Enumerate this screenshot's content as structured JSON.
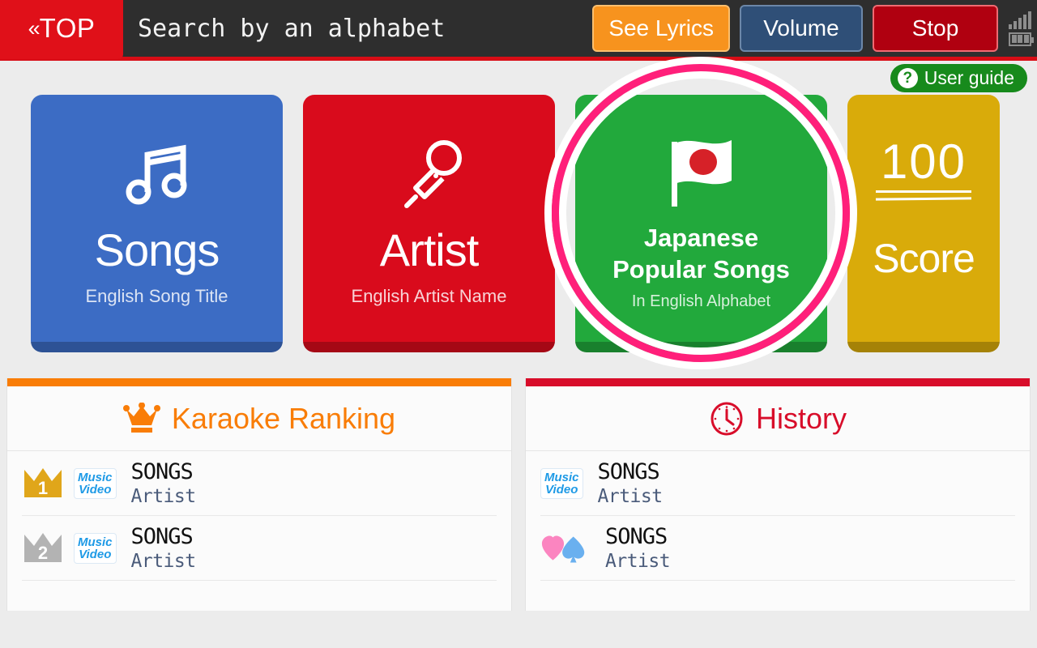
{
  "header": {
    "top_button": "TOP",
    "top_chevron": "«",
    "title": "Search by an alphabet",
    "buttons": [
      {
        "label": "See Lyrics",
        "name": "see-lyrics",
        "color": "#f7931e"
      },
      {
        "label": "Volume",
        "name": "volume",
        "color": "#2f4f77"
      },
      {
        "label": "Stop",
        "name": "stop",
        "color": "#b00010"
      }
    ],
    "status": {
      "signal_icon": "signal-bars-icon",
      "battery_icon": "battery-icon"
    }
  },
  "user_guide": {
    "label": "User guide",
    "icon": "question-mark-icon",
    "color": "#178a1c"
  },
  "cards": [
    {
      "title": "Songs",
      "subtitle": "English Song Title",
      "icon": "music-note-icon",
      "color": "#3c6cc4",
      "highlighted": false
    },
    {
      "title": "Artist",
      "subtitle": "English Artist Name",
      "icon": "microphone-icon",
      "color": "#d90b1c",
      "highlighted": false
    },
    {
      "title_line1": "Japanese",
      "title_line2": "Popular Songs",
      "subtitle": "In English Alphabet",
      "icon": "japan-flag-icon",
      "color": "#22a93c",
      "highlighted": true,
      "highlight_color": "#ff1f7a"
    },
    {
      "number": "100",
      "title": "Score",
      "icon": "score-100-icon",
      "color": "#d9ab0a",
      "highlighted": false
    }
  ],
  "panels": [
    {
      "title": "Karaoke Ranking",
      "icon": "crown-icon",
      "accent": "#f97d07",
      "rows": [
        {
          "rank": "1",
          "rank_style": "gold",
          "badge": {
            "line1": "Music",
            "line2": "Video"
          },
          "song": "SONGS",
          "artist": "Artist"
        },
        {
          "rank": "2",
          "rank_style": "silver",
          "badge": {
            "line1": "Music",
            "line2": "Video"
          },
          "song": "SONGS",
          "artist": "Artist"
        }
      ]
    },
    {
      "title": "History",
      "icon": "clock-icon",
      "accent": "#d80d2a",
      "rows": [
        {
          "rank": "",
          "badge": {
            "line1": "Music",
            "line2": "Video"
          },
          "song": "SONGS",
          "artist": "Artist"
        },
        {
          "rank": "",
          "suits": true,
          "song": "SONGS",
          "artist": "Artist"
        }
      ]
    }
  ]
}
